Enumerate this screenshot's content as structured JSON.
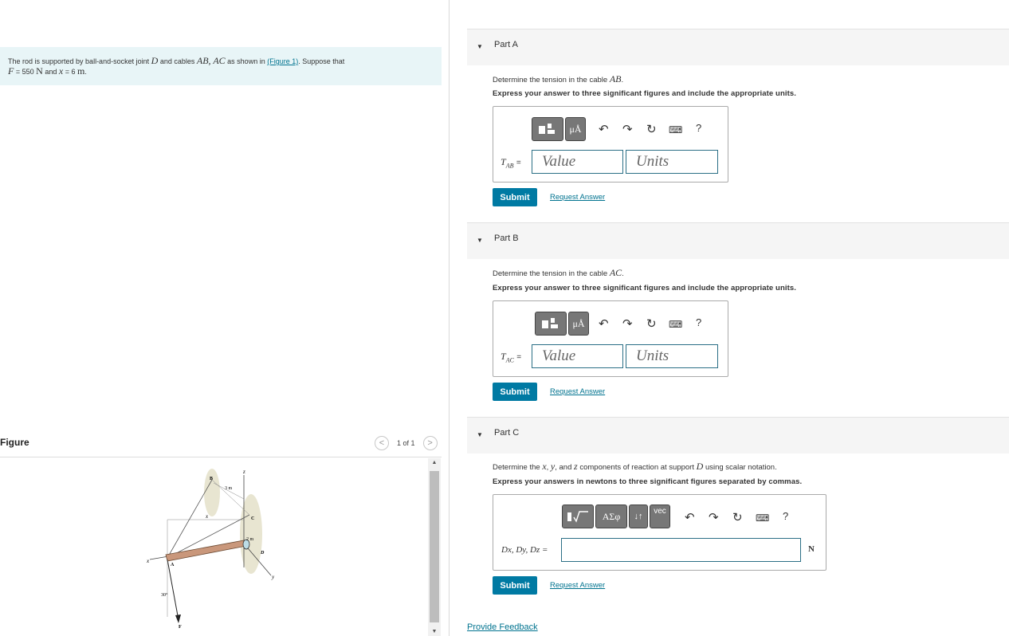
{
  "problem": {
    "intro_text": "The rod is supported by ball-and-socket joint",
    "joint": "D",
    "cables_text": "and cables",
    "cables": "AB, AC",
    "shown_text": "as shown in",
    "figure_link": "(Figure 1)",
    "suppose_text": ". Suppose that",
    "f_var": "F",
    "f_value": "= 550",
    "f_unit": "N",
    "and_text": "and",
    "x_var": "x",
    "x_value": "= 6",
    "x_unit": "m"
  },
  "figure": {
    "title": "Figure",
    "count": "1 of 1",
    "prev_icon": "<",
    "next_icon": ">",
    "labels": {
      "B": "B",
      "C": "C",
      "D": "D",
      "A": "A",
      "F": "F",
      "x_axis": "x",
      "y_axis": "y",
      "z_axis": "z",
      "x_dim": "x",
      "dim_3m": "3 m",
      "dim_2m": "2 m",
      "angle": "30°"
    }
  },
  "part_a": {
    "title": "Part A",
    "question": "Determine the tension in the cable",
    "question_var": "AB",
    "instruction": "Express your answer to three significant figures and include the appropriate units.",
    "tool_mu": "μÅ",
    "tool_help": "?",
    "answer_label": "T",
    "answer_sub": "AB",
    "equals": "=",
    "value_placeholder": "Value",
    "units_placeholder": "Units",
    "submit": "Submit",
    "request": "Request Answer"
  },
  "part_b": {
    "title": "Part B",
    "question": "Determine the tension in the cable",
    "question_var": "AC",
    "instruction": "Express your answer to three significant figures and include the appropriate units.",
    "tool_mu": "μÅ",
    "tool_help": "?",
    "answer_label": "T",
    "answer_sub": "AC",
    "equals": "=",
    "value_placeholder": "Value",
    "units_placeholder": "Units",
    "submit": "Submit",
    "request": "Request Answer"
  },
  "part_c": {
    "title": "Part C",
    "question_pre": "Determine the",
    "var_x": "x",
    "var_y": "y",
    "and_text": ", and",
    "var_z": "z",
    "question_post": "components of reaction at support",
    "support": "D",
    "question_end": "using scalar notation.",
    "instruction": "Express your answers in newtons to three significant figures separated by commas.",
    "tool_sigma": "ΑΣφ",
    "tool_arrows": "↓↑",
    "tool_vec": "vec",
    "tool_help": "?",
    "answer_label": "Dx, Dy, Dz =",
    "unit": "N",
    "submit": "Submit",
    "request": "Request Answer"
  },
  "footer": {
    "feedback": "Provide Feedback"
  }
}
